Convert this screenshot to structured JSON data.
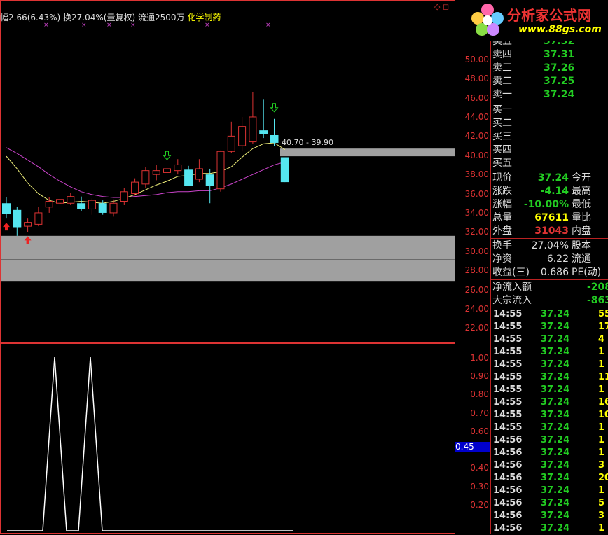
{
  "header": {
    "info_text": "幅2.66(6.43%) 换27.04%(量复权) 流通2500万",
    "sector": "化学制药",
    "icons": "◇ ◻"
  },
  "logo": {
    "name": "分析家公式网",
    "url": "www.88gs.com",
    "icon": "flower-logo-icon"
  },
  "colors": {
    "up": "#dd3333",
    "down": "#55e6f0",
    "ma5": "#f0f07a",
    "ma10": "#cc44cc",
    "grid": "#d33",
    "band": "#a0a0a0"
  },
  "chart_data": [
    {
      "type": "candlestick",
      "ylim": [
        21,
        54
      ],
      "y_ticks": [
        "50.00",
        "48.00",
        "46.00",
        "44.00",
        "42.00",
        "40.00",
        "38.00",
        "36.00",
        "34.00",
        "32.00",
        "30.00",
        "28.00",
        "26.00",
        "24.00",
        "22.00"
      ],
      "y_tick_values": [
        50,
        48,
        46,
        44,
        42,
        40,
        38,
        36,
        34,
        32,
        30,
        28,
        26,
        24,
        22
      ],
      "candles": [
        {
          "o": 35.0,
          "h": 35.6,
          "l": 33.4,
          "c": 33.9
        },
        {
          "o": 34.3,
          "h": 34.6,
          "l": 31.6,
          "c": 32.5
        },
        {
          "o": 32.6,
          "h": 33.4,
          "l": 32.0,
          "c": 33.0
        },
        {
          "o": 32.8,
          "h": 34.6,
          "l": 32.6,
          "c": 34.0
        },
        {
          "o": 34.6,
          "h": 35.6,
          "l": 34.0,
          "c": 35.2
        },
        {
          "o": 35.0,
          "h": 35.5,
          "l": 34.4,
          "c": 35.4
        },
        {
          "o": 35.0,
          "h": 36.1,
          "l": 34.8,
          "c": 35.7
        },
        {
          "o": 35.0,
          "h": 35.7,
          "l": 34.2,
          "c": 34.4
        },
        {
          "o": 34.4,
          "h": 35.5,
          "l": 33.8,
          "c": 35.3
        },
        {
          "o": 35.0,
          "h": 35.3,
          "l": 33.8,
          "c": 34.0
        },
        {
          "o": 34.0,
          "h": 35.4,
          "l": 33.6,
          "c": 35.0
        },
        {
          "o": 35.2,
          "h": 36.6,
          "l": 34.8,
          "c": 36.2
        },
        {
          "o": 36.0,
          "h": 37.6,
          "l": 35.8,
          "c": 37.2
        },
        {
          "o": 37.0,
          "h": 38.8,
          "l": 36.6,
          "c": 38.4
        },
        {
          "o": 38.0,
          "h": 39.0,
          "l": 37.4,
          "c": 38.4
        },
        {
          "o": 38.2,
          "h": 38.8,
          "l": 37.8,
          "c": 38.6
        },
        {
          "o": 38.4,
          "h": 39.6,
          "l": 38.0,
          "c": 39.0
        },
        {
          "o": 38.5,
          "h": 38.9,
          "l": 36.8,
          "c": 36.8
        },
        {
          "o": 37.5,
          "h": 39.6,
          "l": 37.2,
          "c": 38.6
        },
        {
          "o": 38.0,
          "h": 38.6,
          "l": 35.0,
          "c": 36.8
        },
        {
          "o": 36.5,
          "h": 40.5,
          "l": 36.2,
          "c": 40.4
        },
        {
          "o": 40.4,
          "h": 43.5,
          "l": 40.2,
          "c": 42.0
        },
        {
          "o": 41.0,
          "h": 44.0,
          "l": 40.4,
          "c": 43.0
        },
        {
          "o": 41.4,
          "h": 46.6,
          "l": 41.2,
          "c": 44.0
        },
        {
          "o": 42.6,
          "h": 45.8,
          "l": 41.8,
          "c": 42.2
        },
        {
          "o": 42.1,
          "h": 43.8,
          "l": 41.0,
          "c": 41.3
        },
        {
          "o": 39.8,
          "h": 39.8,
          "l": 37.2,
          "c": 37.2
        }
      ],
      "ma5": [
        39.9,
        38.6,
        37.1,
        36.0,
        35.3,
        35.0,
        35.1,
        35.2,
        35.1,
        35.0,
        35.2,
        35.5,
        35.9,
        36.4,
        36.9,
        37.3,
        37.8,
        37.9,
        38.1,
        38.1,
        38.3,
        38.8,
        39.8,
        40.7,
        41.2,
        41.3,
        40.6
      ],
      "ma10": [
        40.8,
        40.2,
        39.5,
        38.8,
        38.0,
        37.3,
        36.7,
        36.2,
        35.9,
        35.7,
        35.6,
        35.6,
        35.7,
        35.8,
        35.9,
        36.1,
        36.2,
        36.2,
        36.3,
        36.3,
        36.6,
        37.0,
        37.5,
        38.0,
        38.5,
        39.0,
        39.3
      ],
      "signals_up": [
        0,
        2
      ],
      "signals_down": [
        15,
        25
      ],
      "resistance_band": [
        39.9,
        40.7
      ],
      "support_band": [
        26.9,
        31.6
      ],
      "annotation": "40.70 - 39.90"
    },
    {
      "type": "line",
      "ylim": [
        0.06,
        1.04
      ],
      "y_ticks": [
        "1.00",
        "0.90",
        "0.80",
        "0.70",
        "0.60",
        "0.50",
        "0.40",
        "0.30",
        "0.20"
      ],
      "y_tick_values": [
        1.0,
        0.9,
        0.8,
        0.7,
        0.6,
        0.5,
        0.4,
        0.3,
        0.2
      ],
      "x": [
        0,
        1,
        2,
        3,
        4,
        5,
        6,
        7,
        8,
        9,
        10,
        11,
        12,
        13,
        14,
        15,
        16,
        17,
        18,
        19,
        20,
        21,
        22,
        23,
        24
      ],
      "values": [
        0,
        0,
        0,
        0,
        1,
        0,
        0,
        1,
        0,
        0,
        0,
        0,
        0,
        0,
        0,
        0,
        0,
        0,
        0,
        0,
        0,
        0,
        0,
        0,
        0
      ],
      "cursor_label": "0.45"
    }
  ],
  "quote": {
    "asks": [
      {
        "label": "卖五",
        "price": "37.32"
      },
      {
        "label": "卖四",
        "price": "37.31"
      },
      {
        "label": "卖三",
        "price": "37.26"
      },
      {
        "label": "卖二",
        "price": "37.25"
      },
      {
        "label": "卖一",
        "price": "37.24"
      }
    ],
    "bids": [
      {
        "label": "买一"
      },
      {
        "label": "买二"
      },
      {
        "label": "买三"
      },
      {
        "label": "买四"
      },
      {
        "label": "买五"
      }
    ],
    "stats": [
      {
        "label": "现价",
        "value": "37.24",
        "label2": "今开",
        "color": "green"
      },
      {
        "label": "涨跌",
        "value": "-4.14",
        "label2": "最高",
        "color": "green"
      },
      {
        "label": "涨幅",
        "value": "-10.00%",
        "label2": "最低",
        "color": "green"
      },
      {
        "label": "总量",
        "value": "67611",
        "label2": "量比",
        "color": "yellow"
      },
      {
        "label": "外盘",
        "value": "31043",
        "label2": "内盘",
        "color": "red"
      }
    ],
    "stats2": [
      {
        "label": "换手",
        "value": "27.04%",
        "label2": "股本"
      },
      {
        "label": "净资",
        "value": "6.22",
        "label2": "流通"
      },
      {
        "label": "收益(三)",
        "value": "0.686",
        "label2": "PE(动)"
      }
    ],
    "flows": [
      {
        "label": "净流入额",
        "value": "-208"
      },
      {
        "label": "大宗流入",
        "value": "-863."
      }
    ],
    "trades": [
      {
        "time": "14:55",
        "price": "37.24",
        "vol": "55"
      },
      {
        "time": "14:55",
        "price": "37.24",
        "vol": "17"
      },
      {
        "time": "14:55",
        "price": "37.24",
        "vol": "4"
      },
      {
        "time": "14:55",
        "price": "37.24",
        "vol": "1"
      },
      {
        "time": "14:55",
        "price": "37.24",
        "vol": "1"
      },
      {
        "time": "14:55",
        "price": "37.24",
        "vol": "11"
      },
      {
        "time": "14:55",
        "price": "37.24",
        "vol": "1"
      },
      {
        "time": "14:55",
        "price": "37.24",
        "vol": "16"
      },
      {
        "time": "14:55",
        "price": "37.24",
        "vol": "10"
      },
      {
        "time": "14:55",
        "price": "37.24",
        "vol": "1"
      },
      {
        "time": "14:56",
        "price": "37.24",
        "vol": "1"
      },
      {
        "time": "14:56",
        "price": "37.24",
        "vol": "1"
      },
      {
        "time": "14:56",
        "price": "37.24",
        "vol": "3"
      },
      {
        "time": "14:56",
        "price": "37.24",
        "vol": "20"
      },
      {
        "time": "14:56",
        "price": "37.24",
        "vol": "1"
      },
      {
        "time": "14:56",
        "price": "37.24",
        "vol": "5"
      },
      {
        "time": "14:56",
        "price": "37.24",
        "vol": "3"
      },
      {
        "time": "14:56",
        "price": "37.24",
        "vol": "1"
      }
    ]
  }
}
